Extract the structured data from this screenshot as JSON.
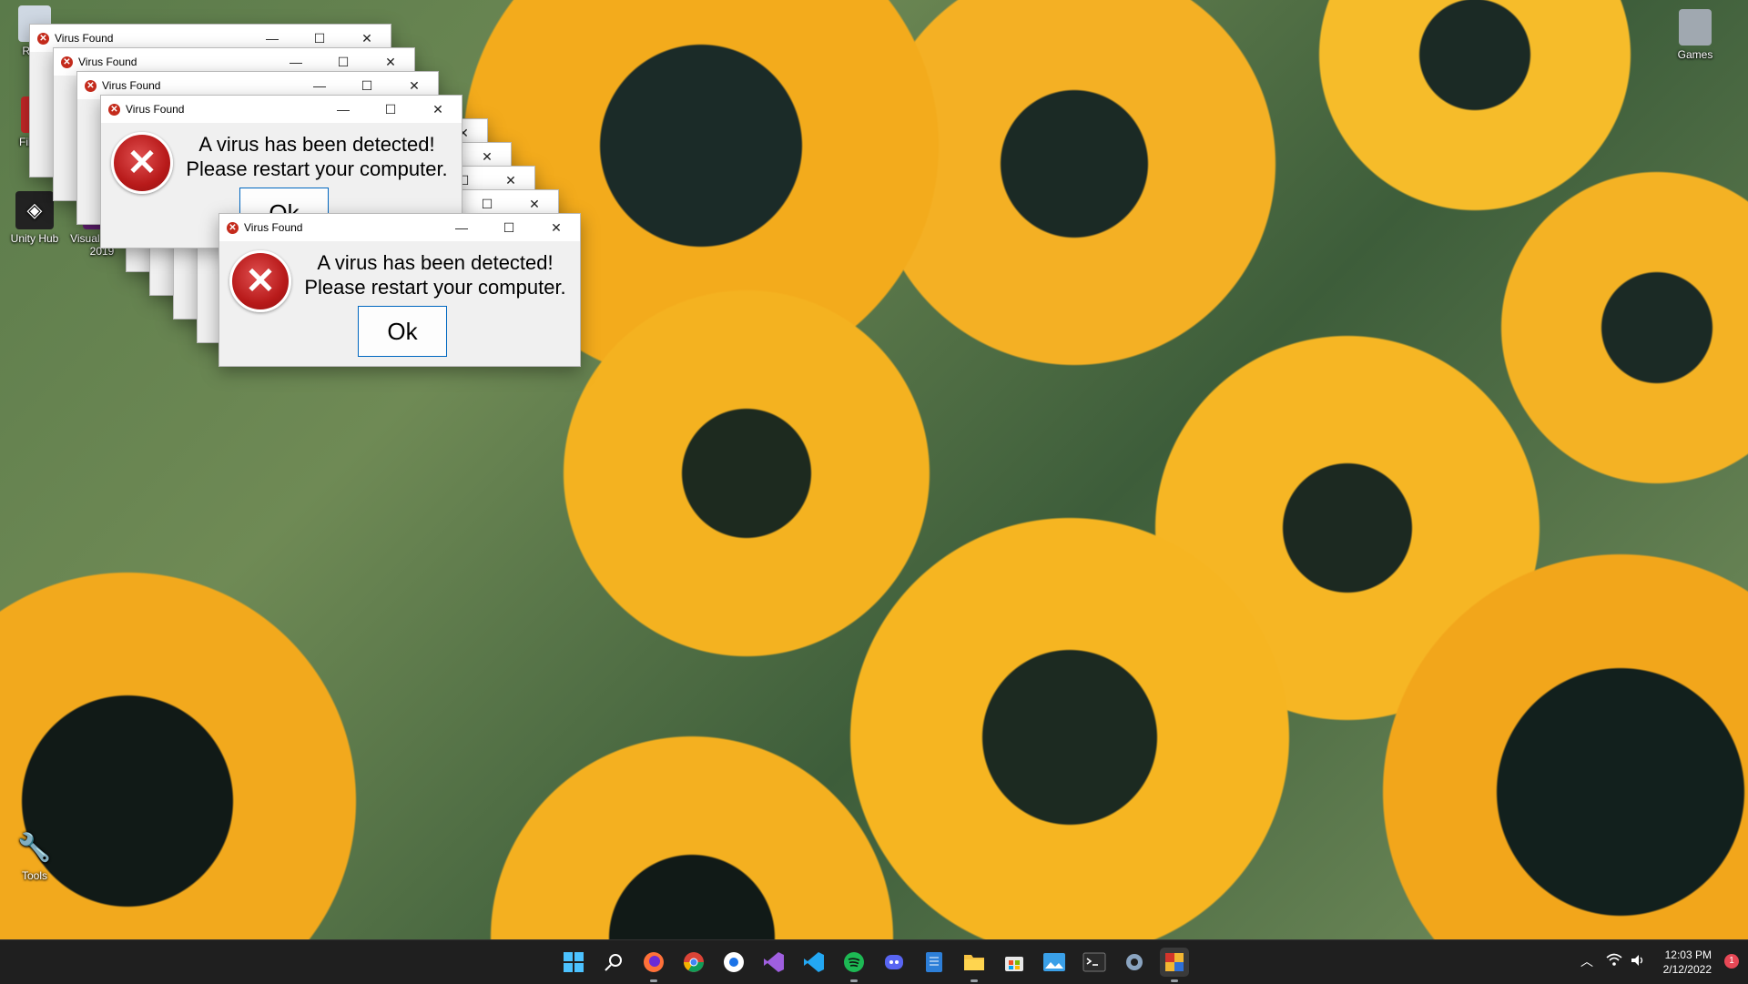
{
  "desktop_icons": [
    {
      "label": "Recy",
      "icon": "recycle-bin-icon"
    },
    {
      "label": "Unity Hub",
      "icon": "unity-hub-icon"
    },
    {
      "label": "Visual Studio 2019",
      "icon": "visual-studio-icon"
    },
    {
      "label": "File Cl",
      "icon": "file-icon"
    },
    {
      "label": "Games",
      "icon": "floppy-disk-icon"
    },
    {
      "label": "Tools",
      "icon": "wrench-icon"
    }
  ],
  "dialog": {
    "title": "Virus Found",
    "message_line1": "A virus has been detected!",
    "message_line2": "Please restart your computer.",
    "ok_label": "Ok",
    "minimize_symbol": "—",
    "maximize_symbol": "☐",
    "close_symbol": "✕",
    "error_icon": "error-x-icon",
    "error_symbol": "✕"
  },
  "taskbar": {
    "icons": [
      "windows-start-icon",
      "search-icon",
      "firefox-icon",
      "chrome-icon",
      "app-icon",
      "visual-studio-icon",
      "vscode-icon",
      "spotify-icon",
      "discord-icon",
      "notepad-icon",
      "file-explorer-icon",
      "store-icon",
      "image-viewer-icon",
      "terminal-icon",
      "settings-icon",
      "virus-app-icon"
    ],
    "tray": {
      "time": "12:03 PM",
      "date": "2/12/2022",
      "notification_count": "1"
    }
  }
}
